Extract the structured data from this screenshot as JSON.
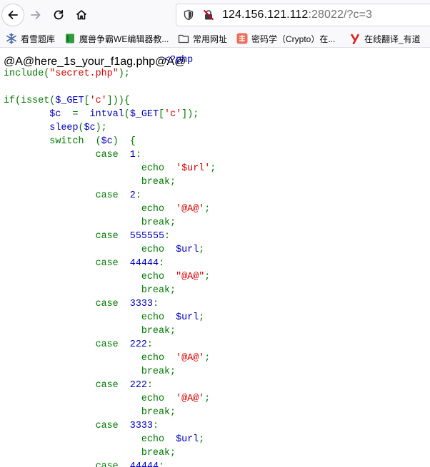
{
  "browser": {
    "url_host": "124.156.121.112",
    "url_rest": ":28022/?c=3",
    "icons": [
      "back-arrow-icon",
      "forward-arrow-icon",
      "reload-icon",
      "home-icon",
      "shield-icon",
      "insecure-lock-icon"
    ]
  },
  "bookmarks": [
    {
      "label": "看雪题库",
      "icon": "snowflake-icon"
    },
    {
      "label": "魔兽争霸WE编辑器教...",
      "icon": "green-book-icon"
    },
    {
      "label": "常用网址",
      "icon": "folder-icon"
    },
    {
      "label": "密码学（Crypto）在...",
      "icon": "jian-shu-icon"
    },
    {
      "label": "在线翻译_有道",
      "icon": "youdao-icon"
    }
  ],
  "page": {
    "heading": "@A@here_1s_your_f1ag.php@A@",
    "code_lines": [
      [
        {
          "t": "                            ",
          "c": "hidden-fill"
        },
        {
          "t": "<?php",
          "c": "c-var"
        }
      ],
      [
        {
          "t": "include(",
          "c": "c-kw"
        },
        {
          "t": "\"secret.php\"",
          "c": "c-str"
        },
        {
          "t": ");",
          "c": "c-kw"
        }
      ],
      [
        {
          "t": "",
          "c": "c-def"
        }
      ],
      [
        {
          "t": "if(isset(",
          "c": "c-kw"
        },
        {
          "t": "$_GET",
          "c": "c-var"
        },
        {
          "t": "[",
          "c": "c-kw"
        },
        {
          "t": "'c'",
          "c": "c-str"
        },
        {
          "t": "])){",
          "c": "c-kw"
        }
      ],
      [
        {
          "t": "        ",
          "c": "c-def"
        },
        {
          "t": "$c ",
          "c": "c-var"
        },
        {
          "t": " = ",
          "c": "c-kw"
        },
        {
          "t": " intval",
          "c": "c-var"
        },
        {
          "t": "(",
          "c": "c-kw"
        },
        {
          "t": "$_GET",
          "c": "c-var"
        },
        {
          "t": "[",
          "c": "c-kw"
        },
        {
          "t": "'c'",
          "c": "c-str"
        },
        {
          "t": "]);",
          "c": "c-kw"
        }
      ],
      [
        {
          "t": "        ",
          "c": "c-def"
        },
        {
          "t": "sleep",
          "c": "c-var"
        },
        {
          "t": "(",
          "c": "c-kw"
        },
        {
          "t": "$c",
          "c": "c-var"
        },
        {
          "t": ");",
          "c": "c-kw"
        }
      ],
      [
        {
          "t": "        ",
          "c": "c-def"
        },
        {
          "t": "switch ",
          "c": "c-kw"
        },
        {
          "t": " (",
          "c": "c-kw"
        },
        {
          "t": "$c",
          "c": "c-var"
        },
        {
          "t": ") ",
          "c": "c-kw"
        },
        {
          "t": " {",
          "c": "c-kw"
        }
      ],
      [
        {
          "t": "                ",
          "c": "c-def"
        },
        {
          "t": "case ",
          "c": "c-kw"
        },
        {
          "t": " 1",
          "c": "c-var"
        },
        {
          "t": ":",
          "c": "c-kw"
        }
      ],
      [
        {
          "t": "                        ",
          "c": "c-def"
        },
        {
          "t": "echo ",
          "c": "c-kw"
        },
        {
          "t": " '$url'",
          "c": "c-str"
        },
        {
          "t": ";",
          "c": "c-kw"
        }
      ],
      [
        {
          "t": "                        ",
          "c": "c-def"
        },
        {
          "t": "break;",
          "c": "c-kw"
        }
      ],
      [
        {
          "t": "                ",
          "c": "c-def"
        },
        {
          "t": "case ",
          "c": "c-kw"
        },
        {
          "t": " 2",
          "c": "c-var"
        },
        {
          "t": ":",
          "c": "c-kw"
        }
      ],
      [
        {
          "t": "                        ",
          "c": "c-def"
        },
        {
          "t": "echo ",
          "c": "c-kw"
        },
        {
          "t": " '@A@'",
          "c": "c-str"
        },
        {
          "t": ";",
          "c": "c-kw"
        }
      ],
      [
        {
          "t": "                        ",
          "c": "c-def"
        },
        {
          "t": "break;",
          "c": "c-kw"
        }
      ],
      [
        {
          "t": "                ",
          "c": "c-def"
        },
        {
          "t": "case ",
          "c": "c-kw"
        },
        {
          "t": " 555555",
          "c": "c-var"
        },
        {
          "t": ":",
          "c": "c-kw"
        }
      ],
      [
        {
          "t": "                        ",
          "c": "c-def"
        },
        {
          "t": "echo ",
          "c": "c-kw"
        },
        {
          "t": " $url",
          "c": "c-var"
        },
        {
          "t": ";",
          "c": "c-kw"
        }
      ],
      [
        {
          "t": "                ",
          "c": "c-def"
        },
        {
          "t": "case ",
          "c": "c-kw"
        },
        {
          "t": " 44444",
          "c": "c-var"
        },
        {
          "t": ":",
          "c": "c-kw"
        }
      ],
      [
        {
          "t": "                        ",
          "c": "c-def"
        },
        {
          "t": "echo ",
          "c": "c-kw"
        },
        {
          "t": " \"@A@\"",
          "c": "c-str"
        },
        {
          "t": ";",
          "c": "c-kw"
        }
      ],
      [
        {
          "t": "                        ",
          "c": "c-def"
        },
        {
          "t": "break;",
          "c": "c-kw"
        }
      ],
      [
        {
          "t": "                ",
          "c": "c-def"
        },
        {
          "t": "case ",
          "c": "c-kw"
        },
        {
          "t": " 3333",
          "c": "c-var"
        },
        {
          "t": ":",
          "c": "c-kw"
        }
      ],
      [
        {
          "t": "                        ",
          "c": "c-def"
        },
        {
          "t": "echo ",
          "c": "c-kw"
        },
        {
          "t": " $url",
          "c": "c-var"
        },
        {
          "t": ";",
          "c": "c-kw"
        }
      ],
      [
        {
          "t": "                        ",
          "c": "c-def"
        },
        {
          "t": "break;",
          "c": "c-kw"
        }
      ],
      [
        {
          "t": "                ",
          "c": "c-def"
        },
        {
          "t": "case ",
          "c": "c-kw"
        },
        {
          "t": " 222",
          "c": "c-var"
        },
        {
          "t": ":",
          "c": "c-kw"
        }
      ],
      [
        {
          "t": "                        ",
          "c": "c-def"
        },
        {
          "t": "echo ",
          "c": "c-kw"
        },
        {
          "t": " '@A@'",
          "c": "c-str"
        },
        {
          "t": ";",
          "c": "c-kw"
        }
      ],
      [
        {
          "t": "                        ",
          "c": "c-def"
        },
        {
          "t": "break;",
          "c": "c-kw"
        }
      ],
      [
        {
          "t": "                ",
          "c": "c-def"
        },
        {
          "t": "case ",
          "c": "c-kw"
        },
        {
          "t": " 222",
          "c": "c-var"
        },
        {
          "t": ":",
          "c": "c-kw"
        }
      ],
      [
        {
          "t": "                        ",
          "c": "c-def"
        },
        {
          "t": "echo ",
          "c": "c-kw"
        },
        {
          "t": " '@A@'",
          "c": "c-str"
        },
        {
          "t": ";",
          "c": "c-kw"
        }
      ],
      [
        {
          "t": "                        ",
          "c": "c-def"
        },
        {
          "t": "break;",
          "c": "c-kw"
        }
      ],
      [
        {
          "t": "                ",
          "c": "c-def"
        },
        {
          "t": "case ",
          "c": "c-kw"
        },
        {
          "t": " 3333",
          "c": "c-var"
        },
        {
          "t": ":",
          "c": "c-kw"
        }
      ],
      [
        {
          "t": "                        ",
          "c": "c-def"
        },
        {
          "t": "echo ",
          "c": "c-kw"
        },
        {
          "t": " $url",
          "c": "c-var"
        },
        {
          "t": ";",
          "c": "c-kw"
        }
      ],
      [
        {
          "t": "                        ",
          "c": "c-def"
        },
        {
          "t": "break;",
          "c": "c-kw"
        }
      ],
      [
        {
          "t": "                ",
          "c": "c-def"
        },
        {
          "t": "case ",
          "c": "c-kw"
        },
        {
          "t": " 44444",
          "c": "c-var"
        },
        {
          "t": ":",
          "c": "c-kw"
        }
      ]
    ]
  },
  "colors": {
    "php_default": "#000000",
    "php_keyword": "#007700",
    "php_variable": "#0000bb",
    "php_string": "#dd0000"
  }
}
